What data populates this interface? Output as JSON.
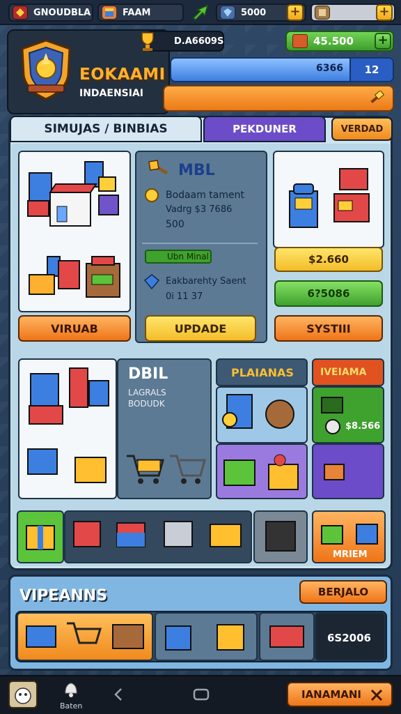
{
  "topbar": {
    "player_name": "GNOUDBLA",
    "shop_label": "FAAM",
    "currency_value": "5000",
    "plus": "+"
  },
  "header": {
    "level_value": "D.A6609S",
    "title": "EOKAAMI",
    "subtitle": "INDAENSIAI",
    "money_value": "45.500",
    "xp_value": "6366",
    "xp_level": "12"
  },
  "tabs": [
    {
      "label": "SIMUJAS / BINBIAS"
    },
    {
      "label": "PEKDUNER"
    },
    {
      "label": "VERDAD"
    }
  ],
  "panel_a": {
    "button": "VIRUAB"
  },
  "panel_b": {
    "title": "MBL",
    "line1": "Bodaam tament",
    "line2": "Vadrg $3 7686",
    "line3": "500",
    "tag": "Ubn Minal",
    "line4": "Eakbarehty Saent",
    "line5": "0i 11 37",
    "button": "UPDADE"
  },
  "panel_c": {
    "price_yellow": "$2.660",
    "price_green": "6?5086",
    "button": "SYSTIII"
  },
  "panel_d": {
    "title": "DBIL",
    "line1": "LAGRALS",
    "line2": "BODUDK"
  },
  "panel_e": {
    "title": "PLAIANAS"
  },
  "panel_f": {
    "title": "IVEIAMA",
    "price": "$8.566"
  },
  "strip_btn": {
    "label": "MRIEM"
  },
  "bottom": {
    "title": "VIPEANNS",
    "button": "BERJALO",
    "value": "6S2006"
  },
  "nav": {
    "bell_label": "Baten",
    "action_button": "IANAMANI"
  },
  "colors": {
    "accent_orange": "#ee7519",
    "accent_green": "#3fa12e",
    "accent_purple": "#6c4cc8",
    "accent_blue": "#3d7fe0"
  }
}
